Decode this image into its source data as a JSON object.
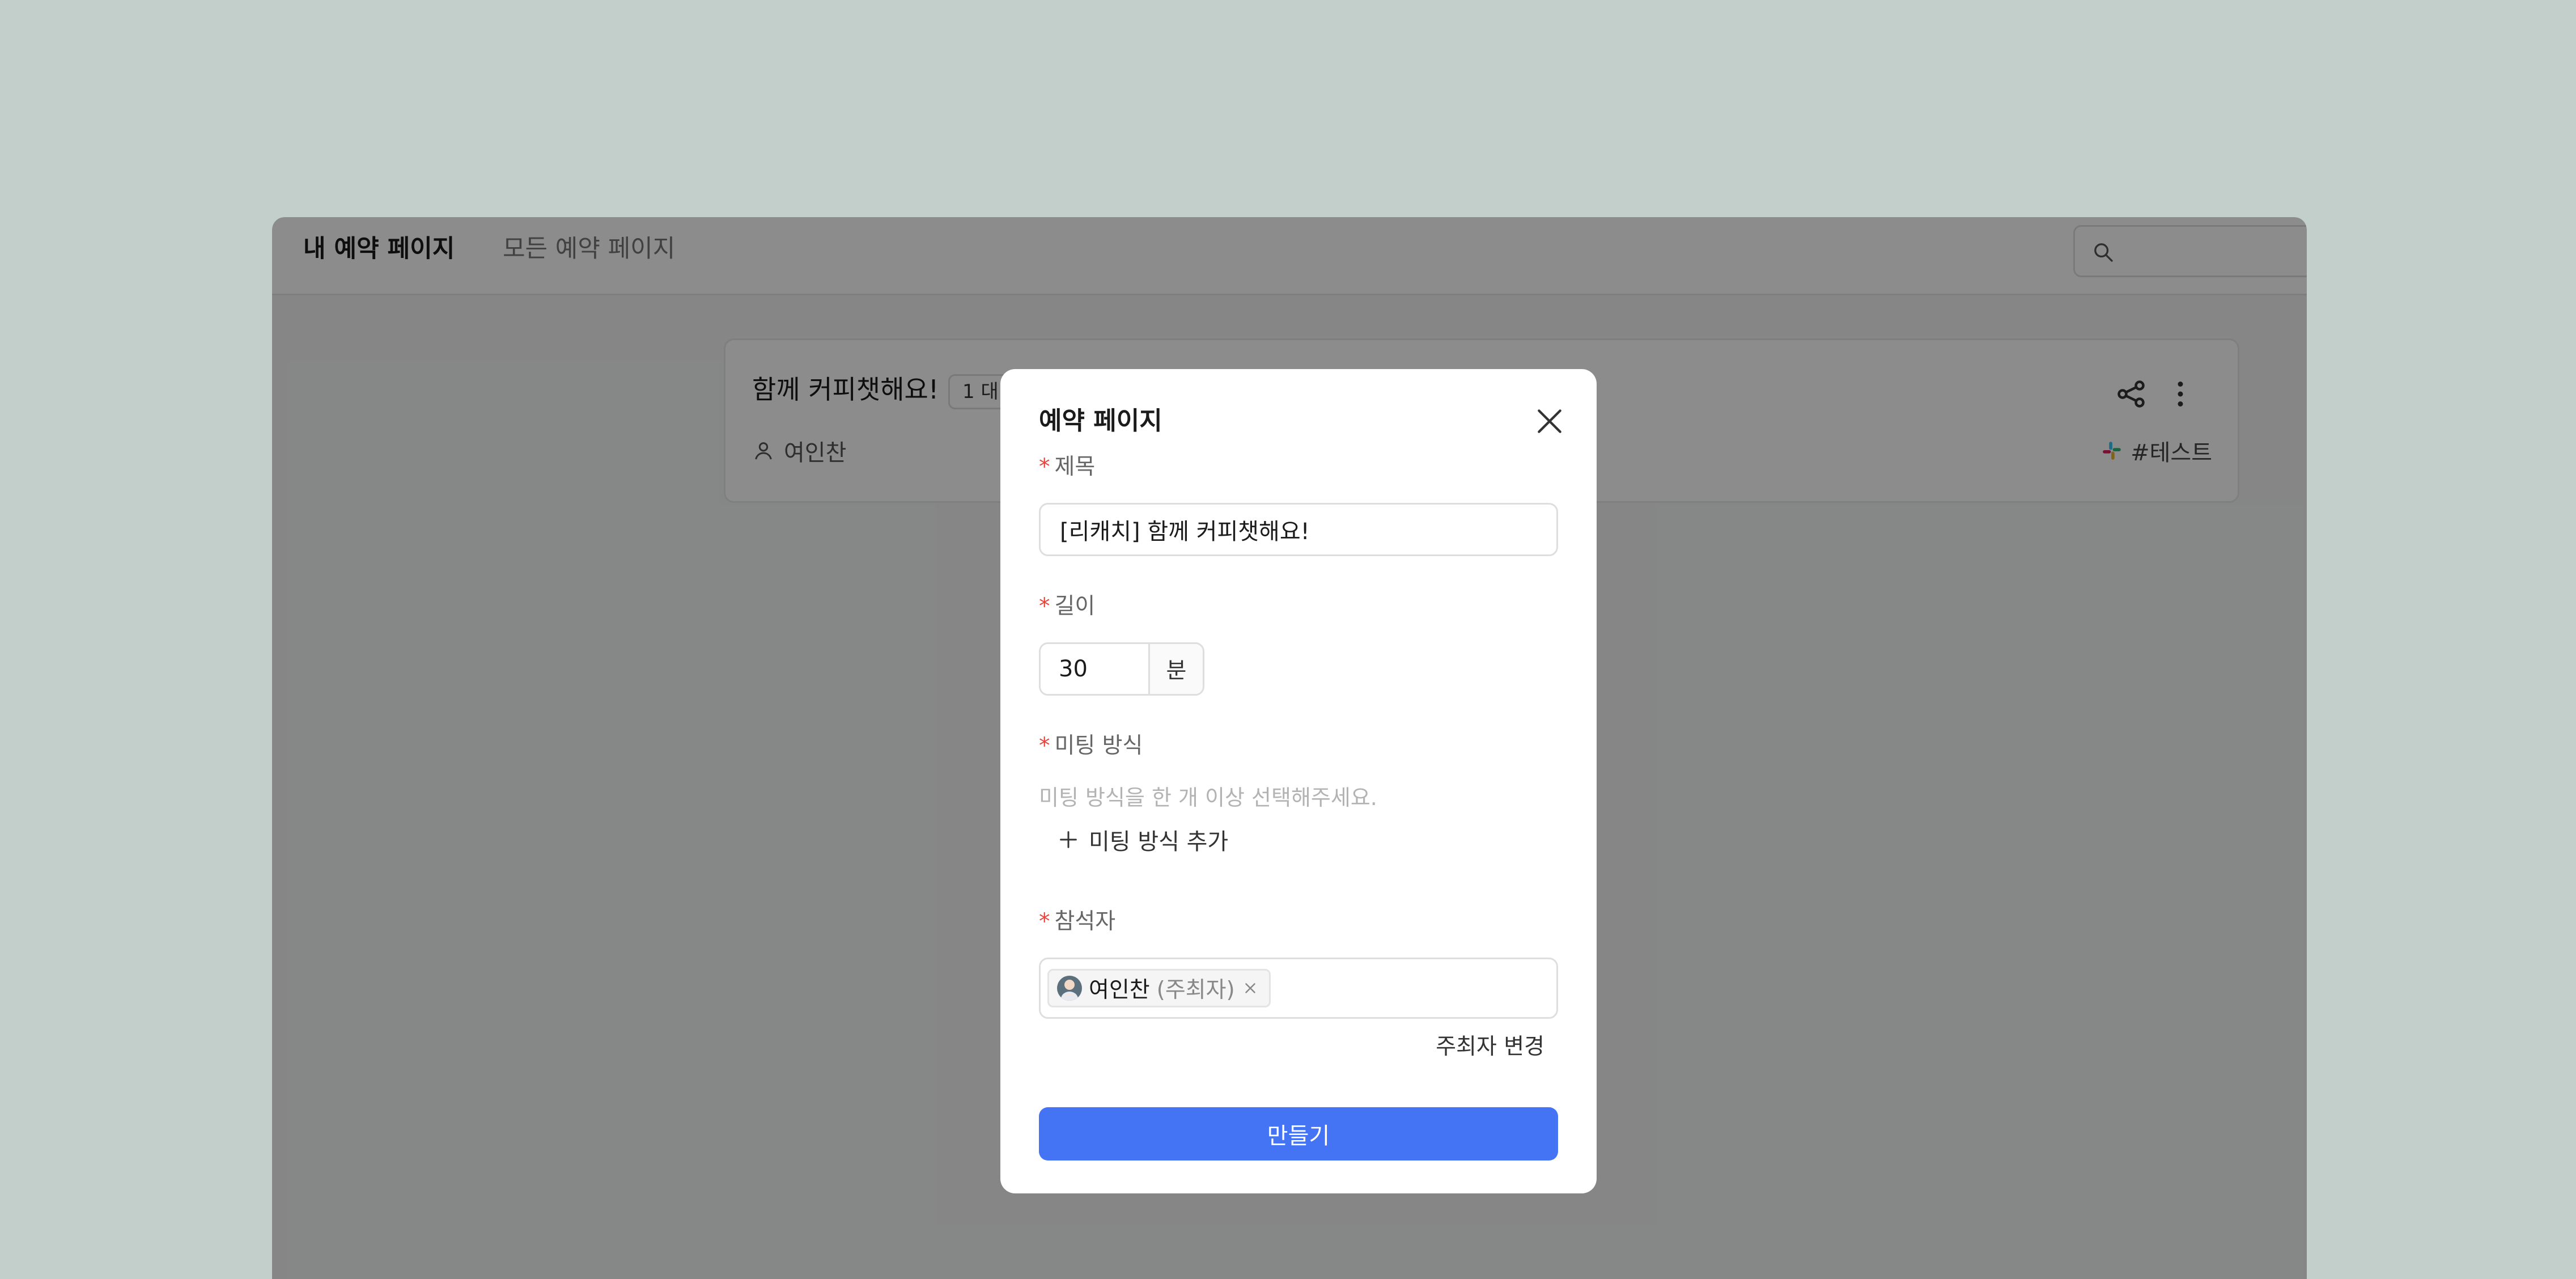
{
  "header": {
    "tabs": [
      {
        "label": "내 예약 페이지",
        "active": true
      },
      {
        "label": "모든 예약 페이지",
        "active": false
      }
    ],
    "search": {
      "icon": "search-icon",
      "placeholder": ""
    }
  },
  "card": {
    "title": "함께 커피챗해요!",
    "badge": "1 대 1",
    "owner": "여인찬",
    "owner_icon": "person-icon",
    "tag": "#테스트",
    "tag_icon": "slack-icon"
  },
  "modal": {
    "title": "예약 페이지",
    "required_mark": "*",
    "fields": {
      "title": {
        "label": "제목",
        "value": "[리캐치] 함께 커피챗해요!"
      },
      "length": {
        "label": "길이",
        "value": "30",
        "unit": "분"
      },
      "meeting_method": {
        "label": "미팅 방식",
        "hint": "미팅 방식을 한 개 이상 선택해주세요.",
        "add_label": "미팅 방식 추가"
      },
      "attendees": {
        "label": "참석자",
        "items": [
          {
            "name": "여인찬",
            "role": "(주최자)"
          }
        ],
        "change_host_label": "주최자 변경"
      }
    },
    "submit_label": "만들기"
  },
  "colors": {
    "primary": "#4474f3",
    "required": "#e8453c",
    "desktop_background": "#c2cfcb"
  }
}
